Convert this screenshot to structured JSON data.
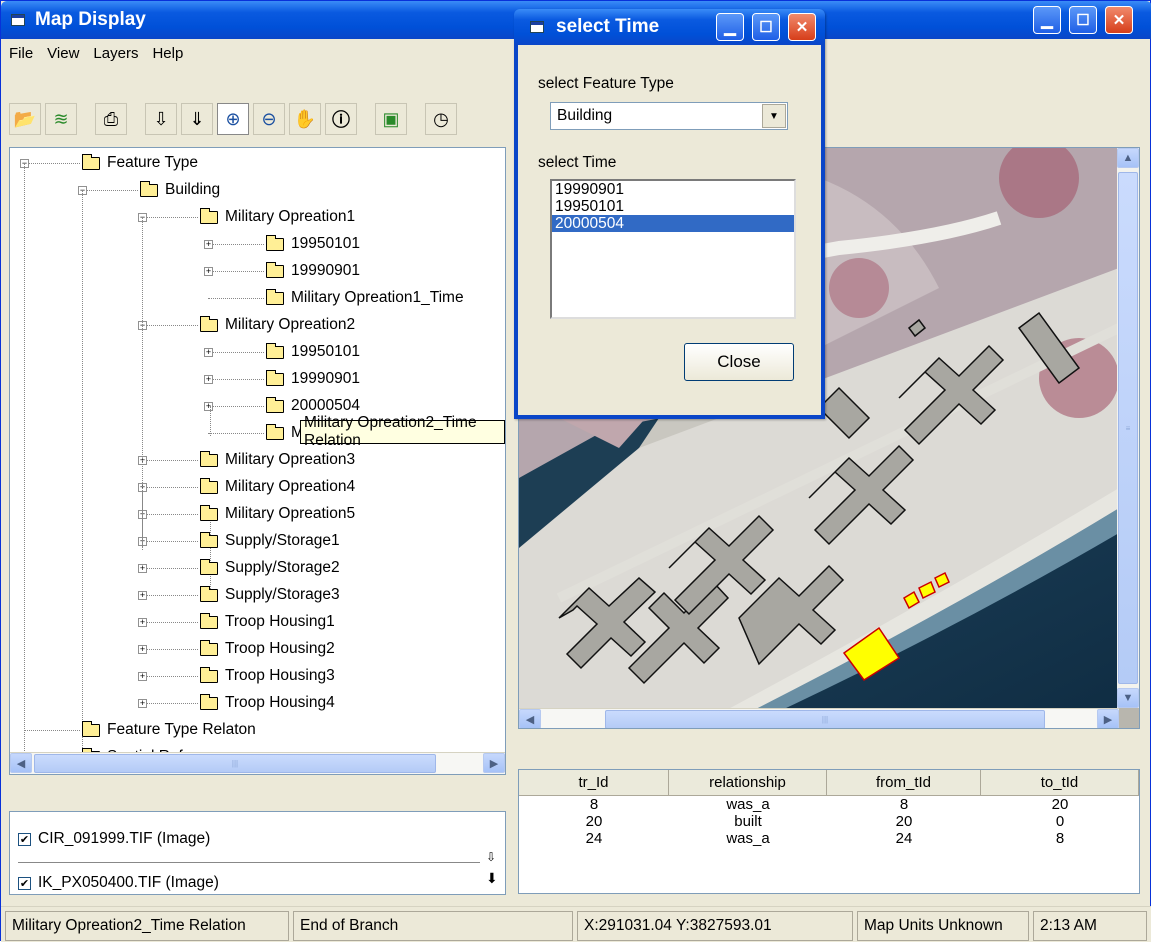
{
  "main_window": {
    "title": "Map Display",
    "title_icon": "app-window-icon",
    "controls": [
      "minimize-icon",
      "maximize-icon",
      "close-icon"
    ]
  },
  "menu": [
    "File",
    "View",
    "Layers",
    "Help"
  ],
  "toolbar": [
    "open-icon",
    "layers-icon",
    "print-icon",
    "import-icon",
    "export-icon",
    "zoom-in-icon",
    "zoom-out-icon",
    "pan-hand-icon",
    "info-icon",
    "map-icon",
    "clock-icon"
  ],
  "tree": [
    {
      "label": "Feature Type",
      "level": 0,
      "expander": "minus"
    },
    {
      "label": "Building",
      "level": 1,
      "expander": "minus"
    },
    {
      "label": "Military Opreation1",
      "level": 2,
      "expander": "minus"
    },
    {
      "label": "19950101",
      "level": 3,
      "expander": "plus"
    },
    {
      "label": "19990901",
      "level": 3,
      "expander": "plus"
    },
    {
      "label": "Military Opreation1_Time",
      "level": 3,
      "expander": "none"
    },
    {
      "label": "Military Opreation2",
      "level": 2,
      "expander": "minus"
    },
    {
      "label": "19950101",
      "level": 3,
      "expander": "plus"
    },
    {
      "label": "19990901",
      "level": 3,
      "expander": "plus"
    },
    {
      "label": "20000504",
      "level": 3,
      "expander": "plus"
    },
    {
      "label": "Military Opreation2_Time Relation",
      "level": 3,
      "expander": "none"
    },
    {
      "label": "Military Opreation3",
      "level": 2,
      "expander": "plus"
    },
    {
      "label": "Military Opreation4",
      "level": 2,
      "expander": "plus"
    },
    {
      "label": "Military Opreation5",
      "level": 2,
      "expander": "plus"
    },
    {
      "label": "Supply/Storage1",
      "level": 2,
      "expander": "plus"
    },
    {
      "label": "Supply/Storage2",
      "level": 2,
      "expander": "plus"
    },
    {
      "label": "Supply/Storage3",
      "level": 2,
      "expander": "plus"
    },
    {
      "label": "Troop Housing1",
      "level": 2,
      "expander": "plus"
    },
    {
      "label": "Troop Housing2",
      "level": 2,
      "expander": "plus"
    },
    {
      "label": "Troop Housing3",
      "level": 2,
      "expander": "plus"
    },
    {
      "label": "Troop Housing4",
      "level": 2,
      "expander": "plus"
    },
    {
      "label": "Feature Type Relaton",
      "level": 0,
      "expander": "none"
    },
    {
      "label": "Spatial Reference",
      "level": 0,
      "expander": "none"
    }
  ],
  "tooltip": "Military Opreation2_Time Relation",
  "layers": [
    {
      "label": "CIR_091999.TIF (Image)",
      "checked": true
    },
    {
      "label": "IK_PX050400.TIF (Image)",
      "checked": true
    }
  ],
  "relation_table": {
    "columns": [
      "tr_Id",
      "relationship",
      "from_tId",
      "to_tId"
    ],
    "rows": [
      [
        "8",
        "was_a",
        "8",
        "20"
      ],
      [
        "20",
        "built",
        "20",
        "0"
      ],
      [
        "24",
        "was_a",
        "24",
        "8"
      ]
    ]
  },
  "status": {
    "node": "Military Opreation2_Time Relation",
    "branch": "End of Branch",
    "coords": "X:291031.04 Y:3827593.01",
    "units": "Map Units Unknown",
    "time": "2:13 AM"
  },
  "dialog": {
    "title": "select Time",
    "feature_label": "select Feature Type",
    "feature_value": "Building",
    "time_label": "select Time",
    "times": [
      "19990901",
      "19950101",
      "20000504"
    ],
    "selected_time": "20000504",
    "close_label": "Close"
  },
  "colors": {
    "titlebar": "#0050d8",
    "selection": "#316ac5",
    "highlight": "#ffff00"
  }
}
